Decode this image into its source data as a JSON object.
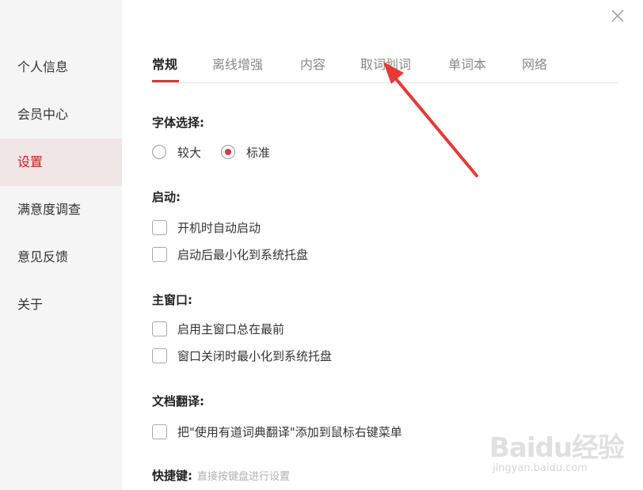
{
  "sidebar": {
    "items": [
      {
        "label": "个人信息",
        "active": false
      },
      {
        "label": "会员中心",
        "active": false
      },
      {
        "label": "设置",
        "active": true
      },
      {
        "label": "满意度调查",
        "active": false
      },
      {
        "label": "意见反馈",
        "active": false
      },
      {
        "label": "关于",
        "active": false
      }
    ]
  },
  "window": {
    "close_icon": "close-icon"
  },
  "tabs": [
    {
      "label": "常规",
      "active": true
    },
    {
      "label": "离线增强",
      "active": false
    },
    {
      "label": "内容",
      "active": false
    },
    {
      "label": "取词划词",
      "active": false
    },
    {
      "label": "单词本",
      "active": false
    },
    {
      "label": "网络",
      "active": false
    }
  ],
  "font": {
    "title": "字体选择:",
    "options": [
      {
        "label": "较大",
        "checked": false
      },
      {
        "label": "标准",
        "checked": true
      }
    ]
  },
  "startup": {
    "title": "启动:",
    "options": [
      {
        "label": "开机时自动启动",
        "checked": false
      },
      {
        "label": "启动后最小化到系统托盘",
        "checked": false
      }
    ]
  },
  "main_window": {
    "title": "主窗口:",
    "options": [
      {
        "label": "启用主窗口总在最前",
        "checked": false
      },
      {
        "label": "窗口关闭时最小化到系统托盘",
        "checked": false
      }
    ]
  },
  "doc_translate": {
    "title": "文档翻译:",
    "options": [
      {
        "label": "把\"使用有道词典翻译\"添加到鼠标右键菜单",
        "checked": false
      }
    ]
  },
  "hotkey": {
    "title": "快捷键:",
    "hint": "直接按键盘进行设置"
  },
  "watermark": {
    "brand": "Baidu经验",
    "url": "jingyan.baidu.com"
  },
  "colors": {
    "accent": "#d23c3c",
    "active_bg": "#f1e6e6",
    "sidebar_bg": "#f5f5f5",
    "arrow": "#e53935"
  }
}
